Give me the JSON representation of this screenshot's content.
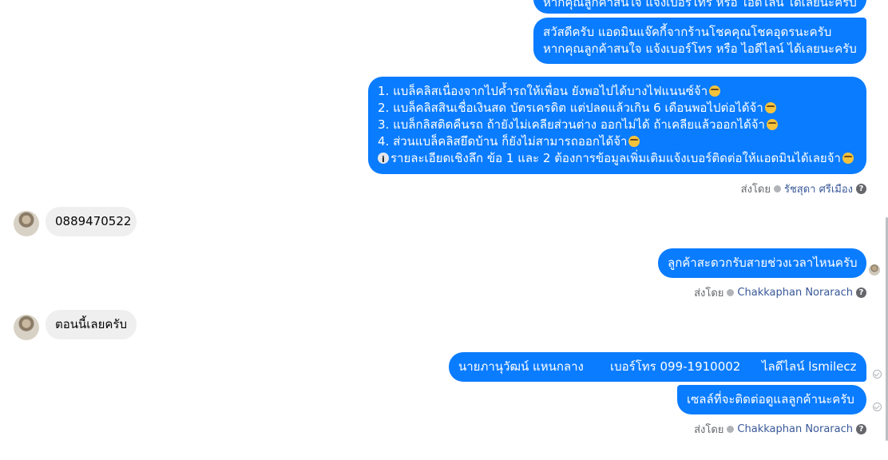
{
  "messages": {
    "top_partial": "หากคุณลูกค้าสนใจ แจ้งเบอร์โทร หรือ ไอดีไลน์ ได้เลยนะครับ",
    "greeting": {
      "line1": "สวัสดีครับ แอดมินแจ๊คกี้จากร้านโชคคุณโชคอุดรนะครับ",
      "line2": "หากคุณลูกค้าสนใจ แจ้งเบอร์โทร หรือ ไอดีไลน์ ได้เลยนะครับ"
    },
    "blacklist": {
      "l1": "1. แบล็คลิสเนื่องจากไปค้ำรถให้เพื่อน ยังพอไปได้บางไฟแนนซ์จ้า",
      "l2": "2. แบล็คลิสสินเชื่อเงินสด บัตรเครดิต แต่ปลดแล้วเกิน 6 เดือนพอไปต่อได้จ้า",
      "l3": "3. แบล็กลิสติดคืนรถ ถ้ายังไม่เคลียส่วนต่าง ออกไม่ได้ ถ้าเคลียแล้วออกได้จ้า",
      "l4": "4. ส่วนแบล็คลิสยึดบ้าน ก็ยังไม่สามารถออกได้จ้า",
      "l5": "รายละเอียดเชิงลึก ข้อ 1 และ 2 ต้องการข้อมูลเพิ่มเติมแจ้งเบอร์ติดต่อให้แอดมินได้เลยจ้า"
    },
    "sent_by_1": {
      "prefix": "ส่งโดย",
      "name": "รัชสุดา ศรีเมือง"
    },
    "phone": "0889470522",
    "ask_time": "ลูกค้าสะดวกรับสายช่วงเวลาไหนครับ",
    "sent_by_2": {
      "prefix": "ส่งโดย",
      "name": "Chakkaphan Norarach"
    },
    "now": "ตอนนี้เลยครับ",
    "contact": {
      "name": "นายภานุวัฒน์ แหนกลาง",
      "phone": "เบอร์โทร 099-1910002",
      "line": "ไลดีไลน์ lsmilecz"
    },
    "seller": "เซลล์ที่จะติดต่อดูแลลูกค้านะครับ",
    "sent_by_3": {
      "prefix": "ส่งโดย",
      "name": "Chakkaphan Norarach"
    },
    "help_glyph": "?"
  },
  "colors": {
    "outgoing": "#0a7cff",
    "incoming": "#efefef",
    "meta": "#65676b"
  }
}
